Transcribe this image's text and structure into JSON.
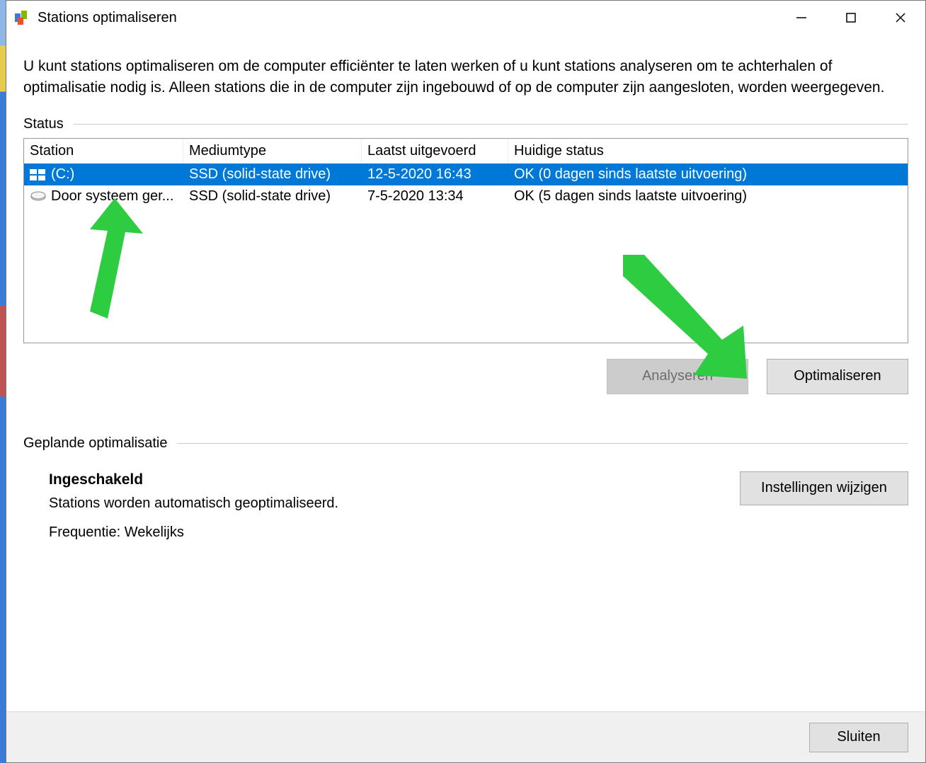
{
  "window": {
    "title": "Stations optimaliseren"
  },
  "intro": "U kunt stations optimaliseren om de computer efficiënter te laten werken of u kunt stations analyseren om te achterhalen of optimalisatie nodig is. Alleen stations die in de computer zijn ingebouwd of op de computer zijn aangesloten, worden weergegeven.",
  "status": {
    "label": "Status",
    "columns": {
      "station": "Station",
      "type": "Mediumtype",
      "last": "Laatst uitgevoerd",
      "current": "Huidige status"
    },
    "rows": [
      {
        "icon": "windows-drive-icon",
        "station": "(C:)",
        "type": "SSD (solid-state drive)",
        "last": "12-5-2020 16:43",
        "current": "OK (0 dagen sinds laatste uitvoering)",
        "selected": true
      },
      {
        "icon": "drive-icon",
        "station": "Door systeem ger...",
        "type": "SSD (solid-state drive)",
        "last": "7-5-2020 13:34",
        "current": "OK (5 dagen sinds laatste uitvoering)",
        "selected": false
      }
    ]
  },
  "actions": {
    "analyze": "Analyseren",
    "optimize": "Optimaliseren"
  },
  "scheduled": {
    "label": "Geplande optimalisatie",
    "enabled": "Ingeschakeld",
    "desc": "Stations worden automatisch geoptimaliseerd.",
    "freq_label": "Frequentie:",
    "freq_value": "Wekelijks",
    "change_settings": "Instellingen wijzigen"
  },
  "footer": {
    "close": "Sluiten"
  }
}
